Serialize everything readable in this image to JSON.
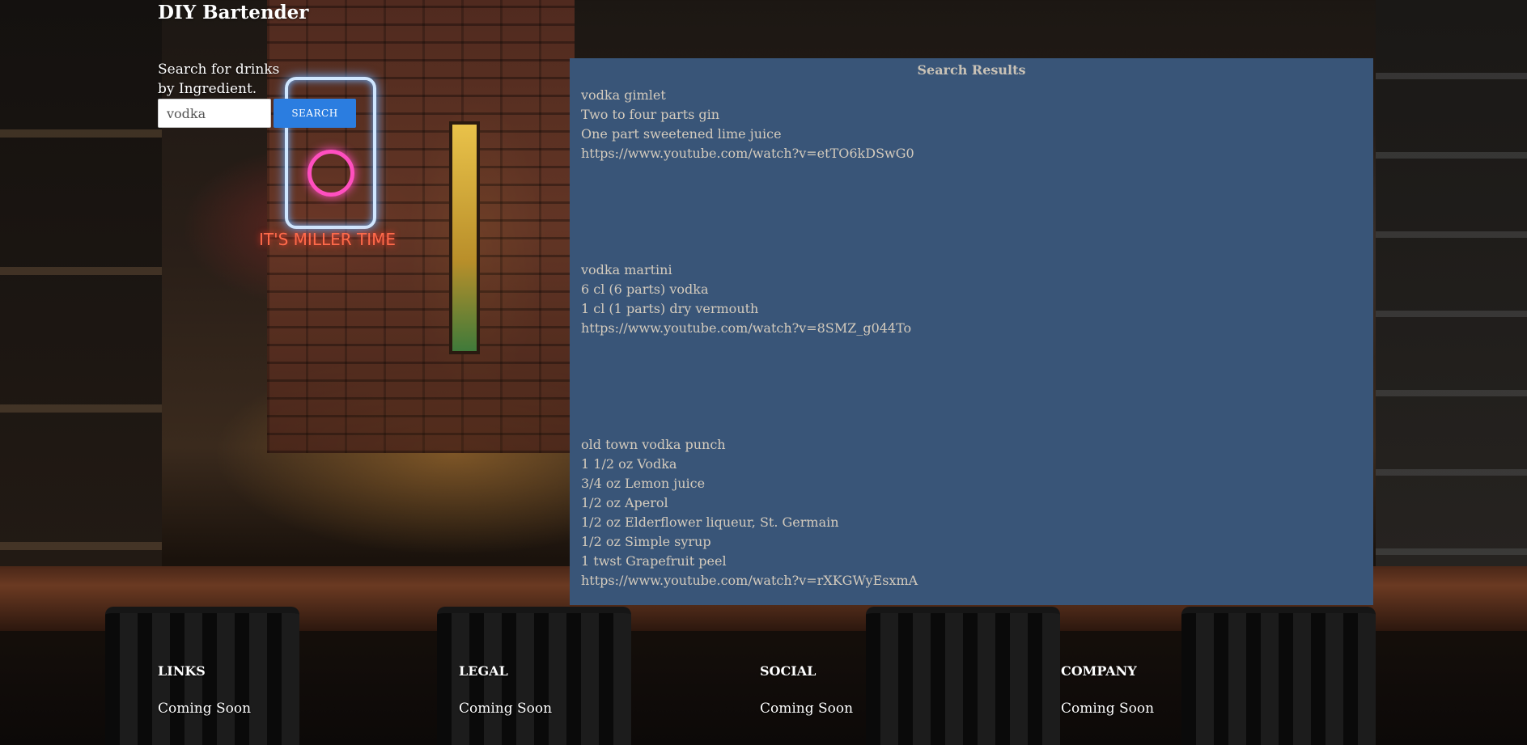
{
  "header": {
    "title": "DIY Bartender"
  },
  "search": {
    "label": "Search for drinks by Ingredient.",
    "value": "vodka",
    "button_label": "SEARCH"
  },
  "background": {
    "neon_sign_text": "IT'S MILLER TIME"
  },
  "results": {
    "heading": "Search Results",
    "drinks": [
      {
        "name": "vodka gimlet",
        "ingredients": [
          "Two to four parts gin",
          "One part sweetened lime juice"
        ],
        "video_url": "https://www.youtube.com/watch?v=etTO6kDSwG0"
      },
      {
        "name": "vodka martini",
        "ingredients": [
          "6 cl (6 parts) vodka",
          "1 cl (1 parts) dry vermouth"
        ],
        "video_url": "https://www.youtube.com/watch?v=8SMZ_g044To"
      },
      {
        "name": "old town vodka punch",
        "ingredients": [
          "1 1/2 oz Vodka",
          "3/4 oz Lemon juice",
          "1/2 oz Aperol",
          "1/2 oz Elderflower liqueur, St. Germain",
          "1/2 oz Simple syrup",
          "1 twst Grapefruit peel"
        ],
        "video_url": "https://www.youtube.com/watch?v=rXKGWyEsxmA"
      }
    ]
  },
  "footer": {
    "columns": [
      {
        "title": "LINKS",
        "text": "Coming Soon"
      },
      {
        "title": "LEGAL",
        "text": "Coming Soon"
      },
      {
        "title": "SOCIAL",
        "text": "Coming Soon"
      },
      {
        "title": "COMPANY",
        "text": "Coming Soon"
      }
    ]
  },
  "colors": {
    "panel_background": "#395578",
    "button_background": "#2b7de0",
    "panel_text": "#d4cbbd"
  }
}
